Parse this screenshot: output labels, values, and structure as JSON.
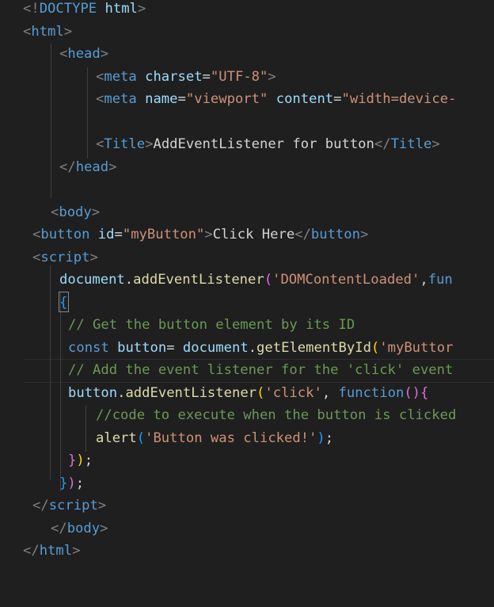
{
  "editor": {
    "language": "html",
    "theme_colors": {
      "background": "#1f1f1f",
      "tag": "#569cd6",
      "attribute": "#9cdcfe",
      "string": "#ce9178",
      "function": "#dcdcaa",
      "comment": "#6a9955",
      "punctuation": "#808080",
      "text": "#d4d4d4",
      "bracket_level_1": "#ffd700",
      "bracket_level_2": "#da70d6",
      "bracket_level_3": "#179fff"
    },
    "lines": [
      [
        [
          "t-punc",
          "<!"
        ],
        [
          "t-tag",
          "DOCTYPE "
        ],
        [
          "t-attr",
          "html"
        ],
        [
          "t-punc",
          ">"
        ]
      ],
      [
        [
          "t-punc",
          "<"
        ],
        [
          "t-tag",
          "html"
        ],
        [
          "t-punc",
          ">"
        ]
      ],
      [
        [
          "t-punc",
          "<"
        ],
        [
          "t-tag",
          "head"
        ],
        [
          "t-punc",
          ">"
        ]
      ],
      [
        [
          "t-punc",
          "<"
        ],
        [
          "t-tag",
          "meta "
        ],
        [
          "t-attr",
          "charset"
        ],
        [
          "t-text",
          "="
        ],
        [
          "t-str",
          "\"UTF-8\""
        ],
        [
          "t-punc",
          ">"
        ]
      ],
      [
        [
          "t-punc",
          "<"
        ],
        [
          "t-tag",
          "meta "
        ],
        [
          "t-attr",
          "name"
        ],
        [
          "t-text",
          "="
        ],
        [
          "t-str",
          "\"viewport\""
        ],
        [
          "t-text",
          " "
        ],
        [
          "t-attr",
          "content"
        ],
        [
          "t-text",
          "="
        ],
        [
          "t-str",
          "\"width=device-"
        ]
      ],
      [],
      [
        [
          "t-punc",
          "<"
        ],
        [
          "t-tag",
          "Title"
        ],
        [
          "t-punc",
          ">"
        ],
        [
          "t-text",
          "AddEventListener for button"
        ],
        [
          "t-punc",
          "</"
        ],
        [
          "t-tag",
          "Title"
        ],
        [
          "t-punc",
          ">"
        ]
      ],
      [
        [
          "t-punc",
          "</"
        ],
        [
          "t-tag",
          "head"
        ],
        [
          "t-punc",
          ">"
        ]
      ],
      [],
      [
        [
          "t-punc",
          "<"
        ],
        [
          "t-tag",
          "body"
        ],
        [
          "t-punc",
          ">"
        ]
      ],
      [
        [
          "t-punc",
          "<"
        ],
        [
          "t-tag",
          "button "
        ],
        [
          "t-attr",
          "id"
        ],
        [
          "t-text",
          "="
        ],
        [
          "t-str",
          "\"myButton\""
        ],
        [
          "t-punc",
          ">"
        ],
        [
          "t-text",
          "Click Here"
        ],
        [
          "t-punc",
          "</"
        ],
        [
          "t-tag",
          "button"
        ],
        [
          "t-punc",
          ">"
        ]
      ],
      [
        [
          "t-punc",
          "<"
        ],
        [
          "t-tag",
          "script"
        ],
        [
          "t-punc",
          ">"
        ]
      ],
      [
        [
          "t-attr",
          "document"
        ],
        [
          "t-text",
          "."
        ],
        [
          "t-fn",
          "addEventListener"
        ],
        [
          "t-b2",
          "("
        ],
        [
          "t-str",
          "'DOMContentLoaded'"
        ],
        [
          "t-text",
          ","
        ],
        [
          "t-kw",
          "fun"
        ]
      ],
      [
        [
          "t-b3",
          "{"
        ]
      ],
      [
        [
          "t-cmt",
          "// Get the button element by its ID"
        ]
      ],
      [
        [
          "t-kw",
          "const "
        ],
        [
          "t-attr",
          "button"
        ],
        [
          "t-text",
          "= "
        ],
        [
          "t-attr",
          "document"
        ],
        [
          "t-text",
          "."
        ],
        [
          "t-fn",
          "getElementById"
        ],
        [
          "t-b1",
          "("
        ],
        [
          "t-str",
          "'myButtor"
        ]
      ],
      [
        [
          "t-cmt",
          "// Add the event listener for the 'click' event"
        ]
      ],
      [
        [
          "t-attr",
          "button"
        ],
        [
          "t-text",
          "."
        ],
        [
          "t-fn",
          "addEventListener"
        ],
        [
          "t-b1",
          "("
        ],
        [
          "t-str",
          "'click'"
        ],
        [
          "t-text",
          ", "
        ],
        [
          "t-kw",
          "function"
        ],
        [
          "t-b2",
          "()"
        ],
        [
          "t-b2",
          "{"
        ]
      ],
      [
        [
          "t-cmt",
          "//code to execute when the button is clicked"
        ]
      ],
      [
        [
          "t-fn",
          "alert"
        ],
        [
          "t-b3",
          "("
        ],
        [
          "t-str",
          "'Button was clicked!'"
        ],
        [
          "t-b3",
          ")"
        ],
        [
          "t-text",
          ";"
        ]
      ],
      [
        [
          "t-b2",
          "}"
        ],
        [
          "t-b1",
          ")"
        ],
        [
          "t-text",
          ";"
        ]
      ],
      [
        [
          "t-b3",
          "}"
        ],
        [
          "t-b2",
          ")"
        ],
        [
          "t-text",
          ";"
        ]
      ],
      [
        [
          "t-punc",
          "</"
        ],
        [
          "t-tag",
          "script"
        ],
        [
          "t-punc",
          ">"
        ]
      ],
      [
        [
          "t-punc",
          "</"
        ],
        [
          "t-tag",
          "body"
        ],
        [
          "t-punc",
          ">"
        ]
      ],
      [
        [
          "t-punc",
          "</"
        ],
        [
          "t-tag",
          "html"
        ],
        [
          "t-punc",
          ">"
        ]
      ]
    ]
  }
}
